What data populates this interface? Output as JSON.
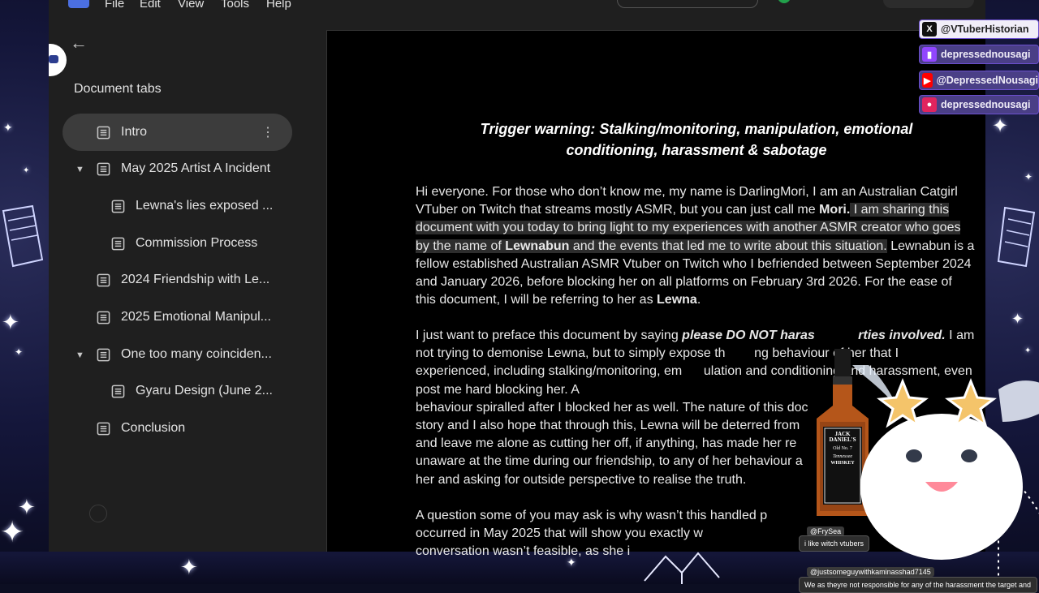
{
  "menu": [
    "File",
    "Edit",
    "View",
    "Tools",
    "Help"
  ],
  "sidebar": {
    "title": "Document tabs",
    "tabs": [
      {
        "label": "Intro"
      },
      {
        "label": "May 2025 Artist A Incident"
      },
      {
        "label": "Lewna's lies exposed ..."
      },
      {
        "label": "Commission Process"
      },
      {
        "label": "2024 Friendship with Le..."
      },
      {
        "label": "2025 Emotional Manipul..."
      },
      {
        "label": "One too many coinciden..."
      },
      {
        "label": "Gyaru Design (June 2..."
      },
      {
        "label": "Conclusion"
      }
    ]
  },
  "document": {
    "title": "Trigger warning: Stalking/monitoring, manipulation, emotional conditioning, harassment & sabotage",
    "p1": {
      "a": "Hi everyone. For those who don’t know me, my name is DarlingMori, I am an Australian Catgirl VTuber on Twitch that streams mostly ASMR, but you can just call me ",
      "b": "Mori.",
      "c": " I am sharing this document with you today to bring light to my experiences with another ASMR creator who goes by the name of ",
      "d": "Lewnabun",
      "e": " and the events that led me to write about this situation.",
      "f": " Lewnabun is a fellow established Australian ASMR Vtuber on Twitch who I befriended between September 2024 and January 2026, before blocking her on all platforms on February 3rd 2026. For the ease of this document, I will be referring to her as ",
      "g": "Lewna",
      "h": "."
    },
    "p2": {
      "a": "I just want to preface this document by saying ",
      "b": "please DO NOT haras",
      "c": "rties involved.",
      "d": " I am not trying to demonise Lewna, but to simply expose th",
      "e": "ng behaviour of her that I experienced, including stalking/monitoring, em",
      "f": "ulation and conditioning and harassment, even post me hard blocking her. A",
      "g": "behaviour spiralled after I blocked her as well. The nature of this doc",
      "h": "story and I also hope that through this, Lewna will be deterred from",
      "i": "and leave me alone as cutting her off, if anything, has made her re",
      "j": "unaware at the time during our friendship, to any of her behaviour a",
      "k": "her and asking for outside perspective to realise the truth."
    },
    "p3": {
      "a": "A question some of you may ask is why wasn’t this handled p",
      "b": "occurred in May 2025 that will show you exactly w",
      "c": "conversation wasn’t feasible, as she i"
    }
  },
  "overlay": {
    "socials": [
      {
        "icon": "x-icon",
        "handle": "@VTuberHistorian",
        "color": "#111111"
      },
      {
        "icon": "twitch-icon",
        "handle": "depressednousagi",
        "color": "#9146ff"
      },
      {
        "icon": "youtube-icon",
        "handle": "@DepressedNousagi",
        "color": "#ff0000"
      },
      {
        "icon": "record-icon",
        "handle": "depressednousagi",
        "color": "#e0245e"
      }
    ],
    "chat": [
      {
        "user": "@FrySea",
        "message": "i like witch vtubers"
      },
      {
        "user": "@justsomeguywithkaminasshad7145",
        "message": "We as theyre not responsible for any of the harassment the target and"
      }
    ],
    "bottle_label": {
      "brand": "JACK DANIEL'S",
      "no": "Old No. 7",
      "style": "Tennessee",
      "kind": "WHISKEY"
    }
  }
}
